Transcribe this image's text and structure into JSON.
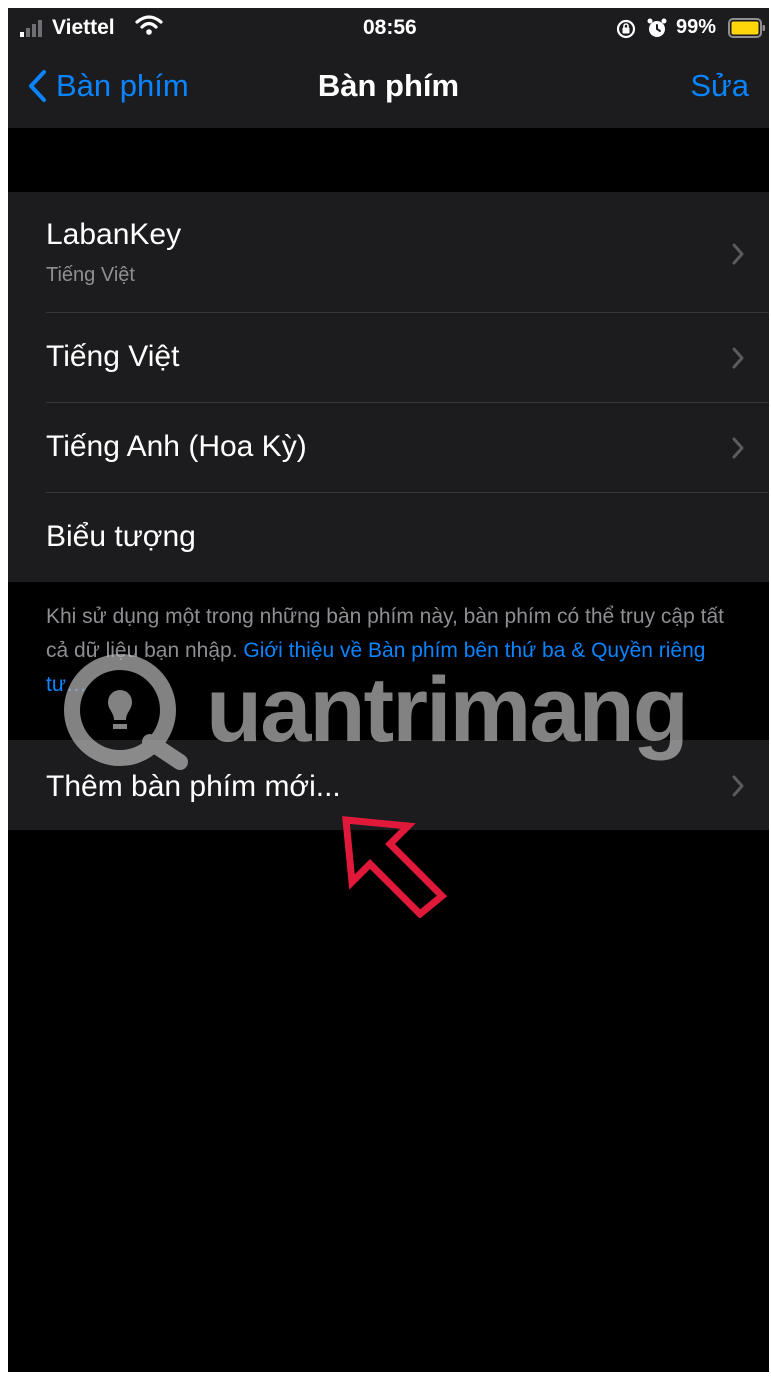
{
  "status_bar": {
    "carrier": "Viettel",
    "time": "08:56",
    "battery_percent": "99%",
    "icons": [
      "signal-icon",
      "wifi-icon",
      "orientation-lock-icon",
      "alarm-icon",
      "battery-icon"
    ]
  },
  "nav": {
    "back_label": "Bàn phím",
    "title": "Bàn phím",
    "edit_label": "Sửa"
  },
  "keyboards": {
    "items": [
      {
        "title": "LabanKey",
        "subtitle": "Tiếng Việt"
      },
      {
        "title": "Tiếng Việt"
      },
      {
        "title": "Tiếng Anh (Hoa Kỳ)"
      },
      {
        "title": "Biểu tượng"
      }
    ]
  },
  "footer": {
    "note": "Khi sử dụng một trong những bàn phím này, bàn phím có thể truy cập tất cả dữ liệu bạn nhập. ",
    "link": "Giới thiệu về Bàn phím bên thứ ba & Quyền riêng tư…"
  },
  "add_keyboard": {
    "label": "Thêm bàn phím mới..."
  },
  "watermark": {
    "text": "uantrimang"
  },
  "colors": {
    "background": "#000000",
    "cell": "#1c1c1e",
    "accent": "#0a84ff",
    "secondary_text": "#8e8e93",
    "annotation": "#e0193a",
    "battery": "#ffd60a"
  }
}
